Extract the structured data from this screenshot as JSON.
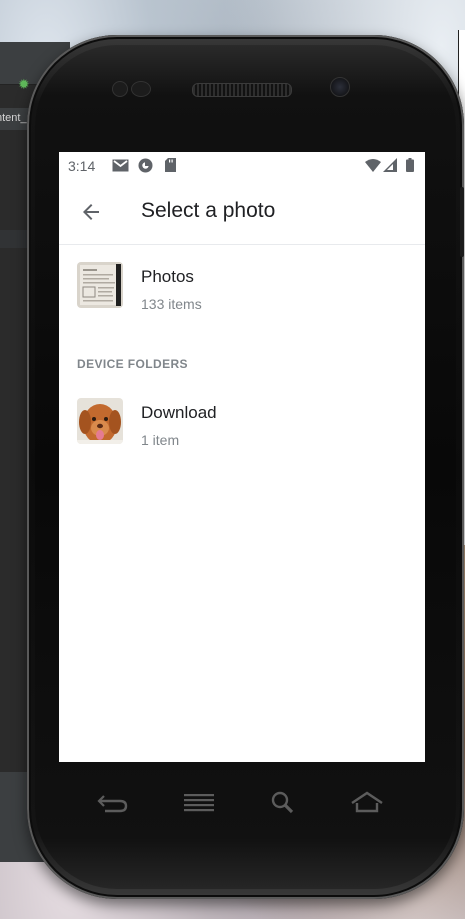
{
  "ide": {
    "tab_label": "ntent_"
  },
  "statusbar": {
    "time": "3:14",
    "icons": [
      "gmail-icon",
      "app-notification-icon",
      "sd-card-icon",
      "wifi-icon",
      "cell-signal-icon",
      "battery-icon"
    ]
  },
  "appbar": {
    "title": "Select a photo",
    "back_icon": "arrow-back-icon"
  },
  "albums": [
    {
      "name": "Photos",
      "count": "133 items",
      "thumb": "document-photo-thumbnail"
    }
  ],
  "section_header": "DEVICE FOLDERS",
  "folders": [
    {
      "name": "Download",
      "count": "1 item",
      "thumb": "dog-photo-thumbnail"
    }
  ],
  "navbar": {
    "keys": [
      "back-key-icon",
      "menu-key-icon",
      "search-key-icon",
      "home-key-icon"
    ]
  },
  "colors": {
    "text_primary": "#202124",
    "text_secondary": "#80868b",
    "status_icons": "#5f6368"
  }
}
